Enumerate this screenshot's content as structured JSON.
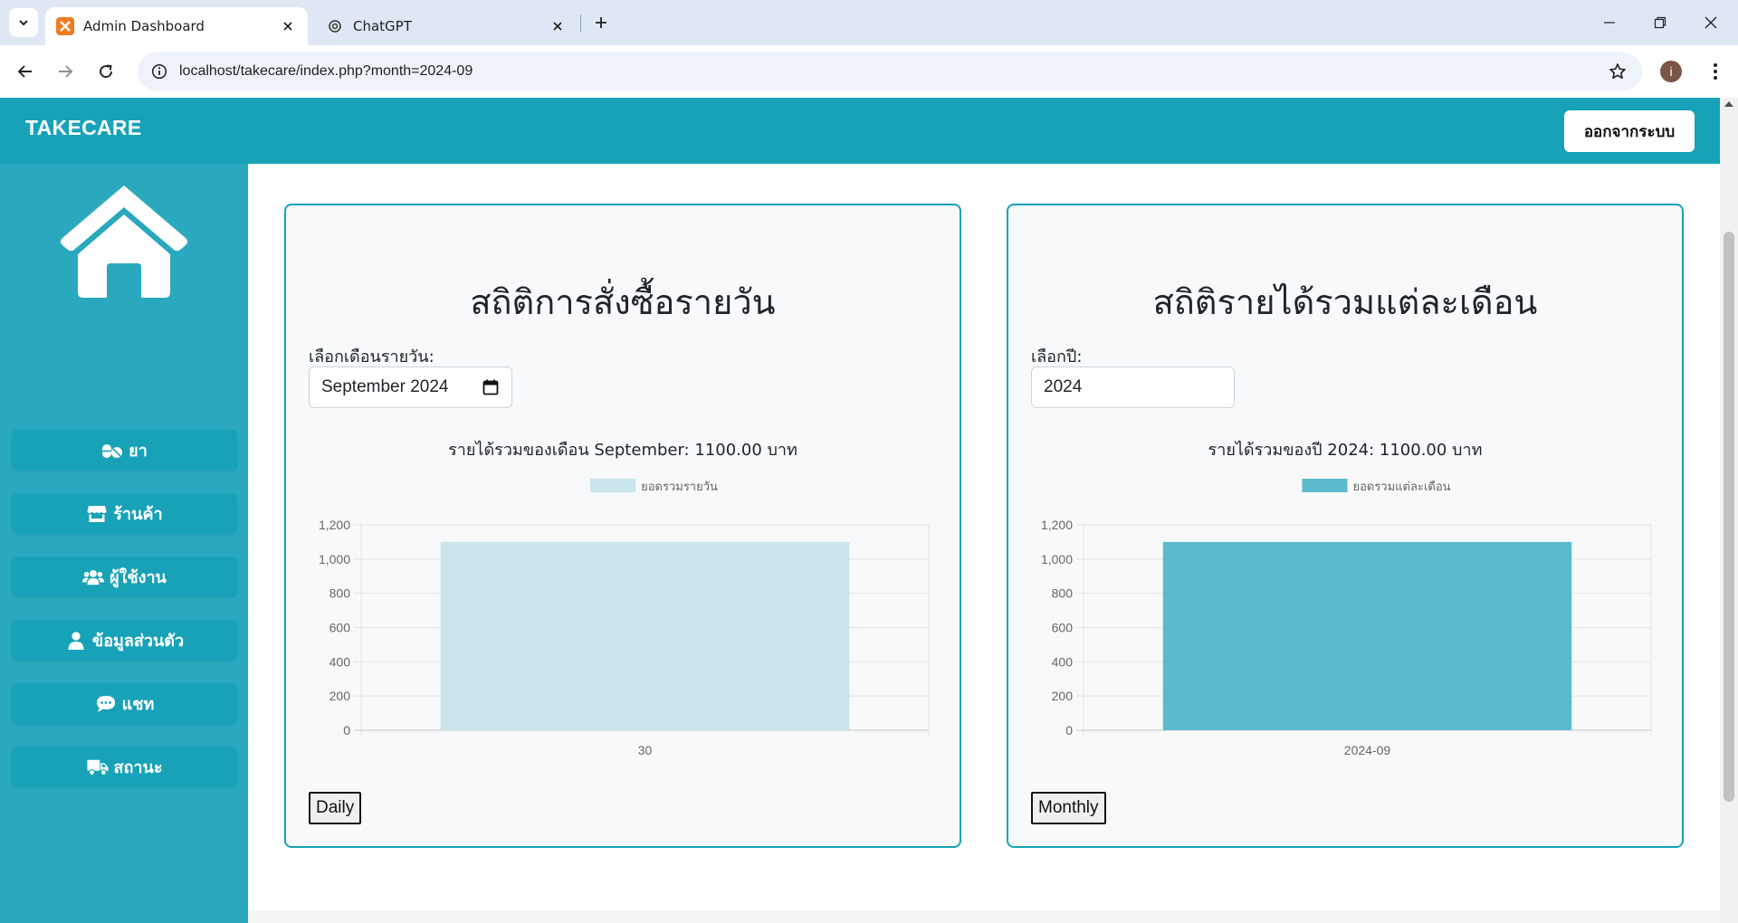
{
  "browser": {
    "tabs": [
      {
        "title": "Admin Dashboard",
        "active": true,
        "favicon": "xampp-icon"
      },
      {
        "title": "ChatGPT",
        "active": false,
        "favicon": "openai-icon"
      }
    ],
    "url": "localhost/takecare/index.php?month=2024-09",
    "profile_initial": "i"
  },
  "navbar": {
    "brand": "TAKECARE",
    "logout_label": "ออกจากระบบ"
  },
  "sidebar": {
    "items": [
      {
        "label": "ยา",
        "icon": "pills-icon"
      },
      {
        "label": "ร้านค้า",
        "icon": "store-icon"
      },
      {
        "label": "ผู้ใช้งาน",
        "icon": "users-icon"
      },
      {
        "label": "ข้อมูลส่วนตัว",
        "icon": "user-icon"
      },
      {
        "label": "แชท",
        "icon": "comment-icon"
      },
      {
        "label": "สถานะ",
        "icon": "truck-icon"
      }
    ]
  },
  "daily": {
    "title": "สถิติการสั่งซื้อรายวัน",
    "select_label": "เลือกเดือนรายวัน:",
    "month_value": "September 2024",
    "total_text": "รายได้รวมของเดือน September: 1100.00 บาท",
    "button_label": "Daily"
  },
  "monthly": {
    "title": "สถิติรายได้รวมแต่ละเดือน",
    "select_label": "เลือกปี:",
    "year_value": "2024",
    "total_text": "รายได้รวมของปี 2024: 1100.00 บาท",
    "button_label": "Monthly"
  },
  "chart_data": [
    {
      "type": "bar",
      "categories": [
        "30"
      ],
      "series": [
        {
          "name": "ยอดรวมรายวัน",
          "values": [
            1100
          ],
          "color": "#cbe5ec"
        }
      ],
      "ylim": [
        0,
        1200
      ],
      "yticks": [
        "0",
        "200",
        "400",
        "600",
        "800",
        "1,000",
        "1,200"
      ],
      "grid": true,
      "legend": "top"
    },
    {
      "type": "bar",
      "categories": [
        "2024-09"
      ],
      "series": [
        {
          "name": "ยอดรวมแต่ละเดือน",
          "values": [
            1100
          ],
          "color": "#5bbacc"
        }
      ],
      "ylim": [
        0,
        1200
      ],
      "yticks": [
        "0",
        "200",
        "400",
        "600",
        "800",
        "1,000",
        "1,200"
      ],
      "grid": true,
      "legend": "top"
    }
  ]
}
